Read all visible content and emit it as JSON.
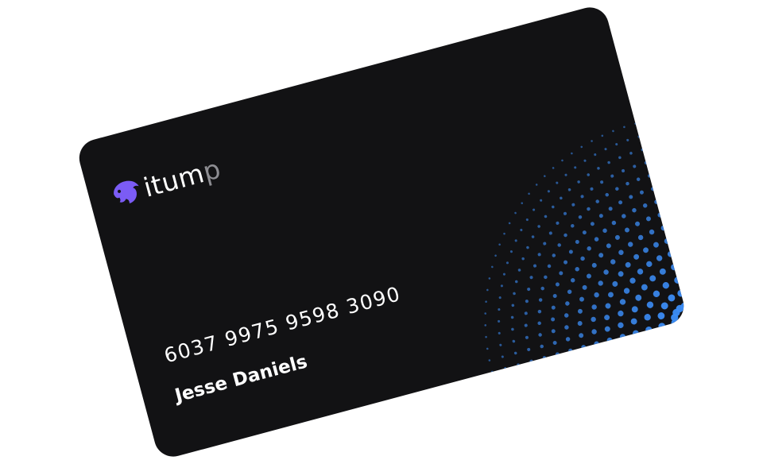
{
  "card": {
    "brand": {
      "name_main": "itum",
      "name_tail": "p",
      "logo_icon": "panther-head-icon",
      "logo_color": "#7b5cf5"
    },
    "number": "6037 9975 9598 3090",
    "holder_name": "Jesse Daniels",
    "colors": {
      "background": "#121214",
      "text": "#ffffff",
      "dot_pattern": "#3b8cf5",
      "brand_tail": "#8d8d92"
    }
  }
}
